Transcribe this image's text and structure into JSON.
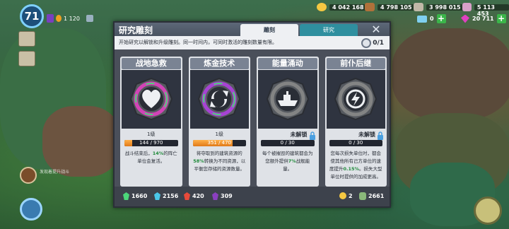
{
  "hud": {
    "level": "71",
    "player_resource": "1 120",
    "gold": "4 042 168",
    "wood": "4 798 105",
    "stone": "3 998 015",
    "iron": "5 113 453",
    "diamonds": "0",
    "crystals": "20 711"
  },
  "dialog": {
    "title": "研究雕刻",
    "tabs": [
      {
        "label": "雕刻",
        "active": true
      },
      {
        "label": "研究",
        "active": false
      }
    ],
    "close_icon": "close-icon",
    "subtitle": "开始研究以解锁和升级雕刻。同一时间内，可同时激活的雕刻数量有限。",
    "active_count": "0/1",
    "cards": [
      {
        "title": "战地急救",
        "icon": "heart-medal-icon",
        "ring_color": "#e040c0",
        "level": "1级",
        "locked": false,
        "progress_label": "144 / 970",
        "progress": 0.148,
        "desc_before": "战斗结束后，",
        "desc_hi": "14%",
        "desc_after": "的阵亡单位会复活。"
      },
      {
        "title": "炼金技术",
        "icon": "alchemy-medal-icon",
        "ring_color": "#b040e0",
        "level": "1级",
        "locked": false,
        "progress_label": "351 / 470",
        "progress": 0.747,
        "desc_before": "将夺取到的建筑资源的",
        "desc_hi": "58%",
        "desc_after": "转换为不同资源，以平衡您存储的资源数量。"
      },
      {
        "title": "能量涌动",
        "icon": "ship-medal-icon",
        "ring_color": "#888888",
        "level": "未解锁",
        "locked": true,
        "progress_label": "0 / 30",
        "progress": 0,
        "desc_before": "每个被摧毁的建筑都会为您额外提供",
        "desc_hi": "7%",
        "desc_after": "战舰能量。"
      },
      {
        "title": "前仆后继",
        "icon": "lightning-medal-icon",
        "ring_color": "#888888",
        "level": "未解锁",
        "locked": true,
        "progress_label": "0 / 30",
        "progress": 0,
        "desc_before": "您每次损失单位时，都会使其他所有己方单位的速度提升",
        "desc_hi": "0.15%",
        "desc_after": "。损失大型单位时提供的加成更高。"
      }
    ],
    "footer": {
      "green_frags": "1660",
      "blue_frags": "2156",
      "red_frags": "420",
      "purple_frags": "309",
      "coins": "2",
      "seeds": "2661"
    }
  },
  "chat_preview": "发现着提升战斗"
}
